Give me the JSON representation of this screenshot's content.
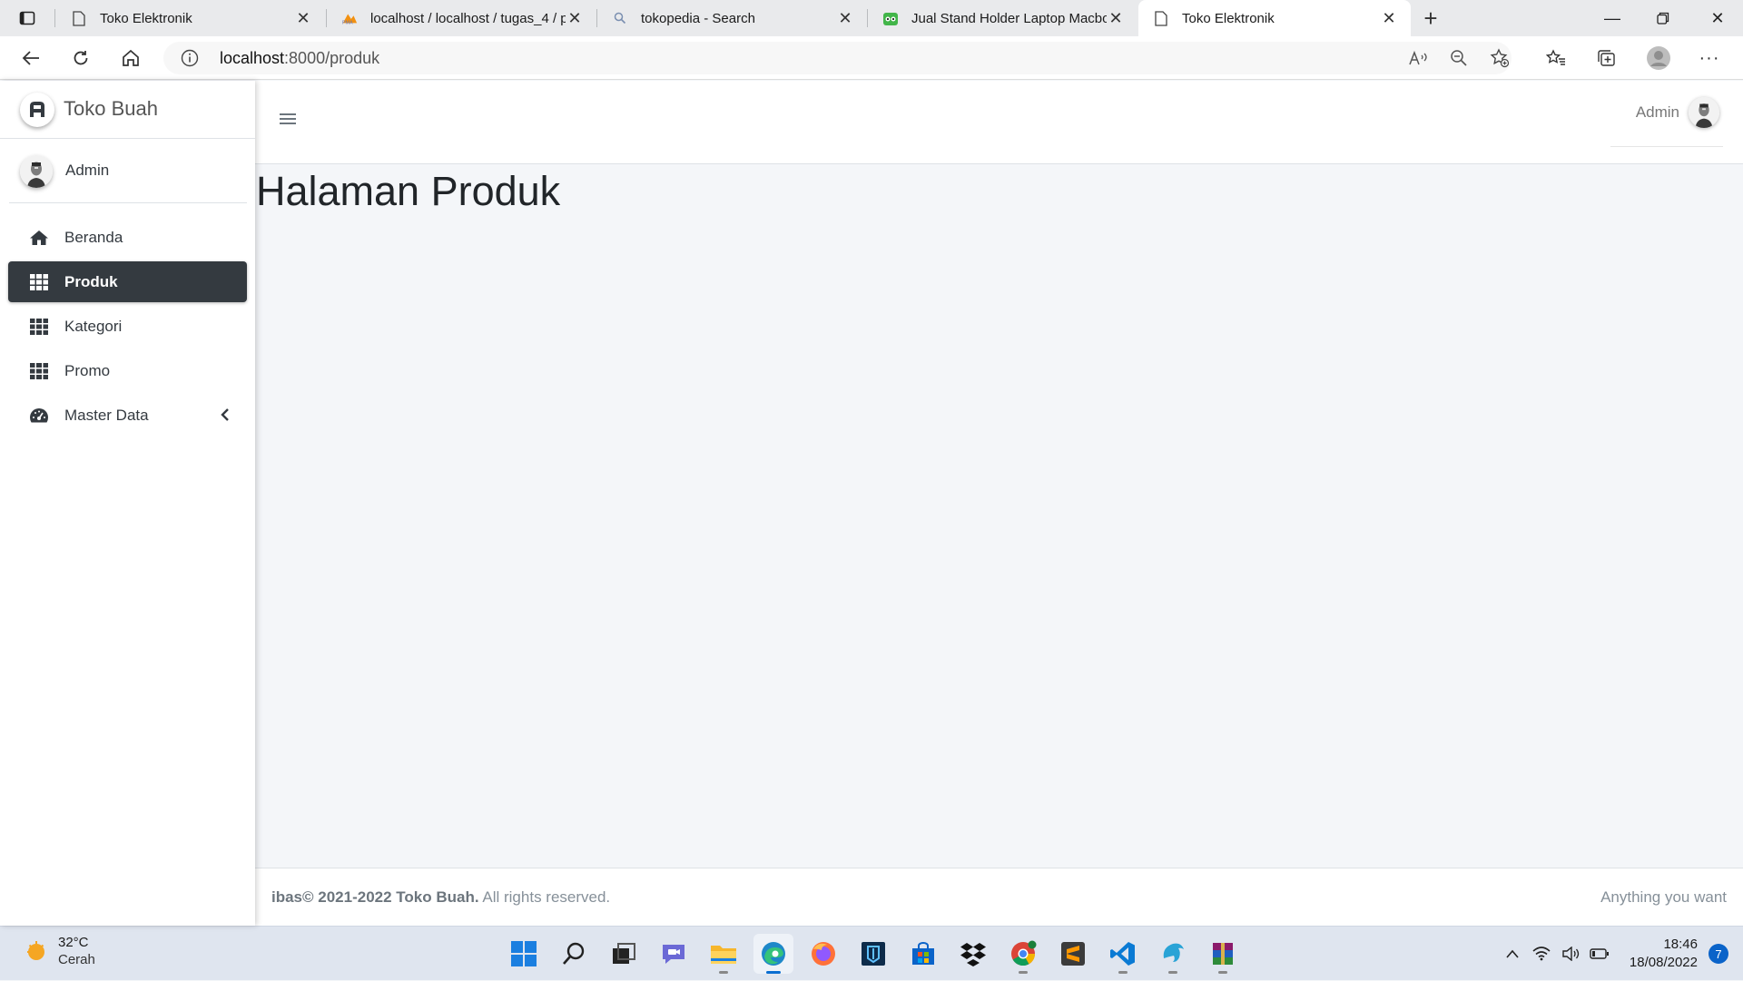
{
  "browser": {
    "tabs": [
      {
        "title": "Toko Elektronik",
        "icon": "page-icon",
        "active": false
      },
      {
        "title": "localhost / localhost / tugas_4 / p",
        "icon": "phpmyadmin-icon",
        "active": false
      },
      {
        "title": "tokopedia - Search",
        "icon": "search-icon",
        "active": false
      },
      {
        "title": "Jual Stand Holder Laptop Macbo",
        "icon": "tokopedia-icon",
        "active": false
      },
      {
        "title": "Toko Elektronik",
        "icon": "page-icon",
        "active": true
      }
    ],
    "url_host": "localhost",
    "url_path": ":8000/produk"
  },
  "sidebar": {
    "brand": "Toko Buah",
    "user": "Admin",
    "items": [
      {
        "label": "Beranda",
        "icon": "home-icon"
      },
      {
        "label": "Produk",
        "icon": "grid-icon"
      },
      {
        "label": "Kategori",
        "icon": "grid-icon"
      },
      {
        "label": "Promo",
        "icon": "grid-icon"
      },
      {
        "label": "Master Data",
        "icon": "dashboard-icon"
      }
    ]
  },
  "navbar": {
    "user": "Admin"
  },
  "content": {
    "title": "Halaman Produk"
  },
  "footer": {
    "left_prefix": "ibas© 2021-2022 Toko Buah.",
    "left_suffix": " All rights reserved.",
    "right": "Anything you want"
  },
  "taskbar": {
    "temperature": "32°C",
    "condition": "Cerah",
    "time": "18:46",
    "date": "18/08/2022",
    "notifications": "7"
  },
  "colors": {
    "sidebar_active": "#343a40",
    "content_bg": "#f4f6f9",
    "accent": "#0a6ed1"
  }
}
